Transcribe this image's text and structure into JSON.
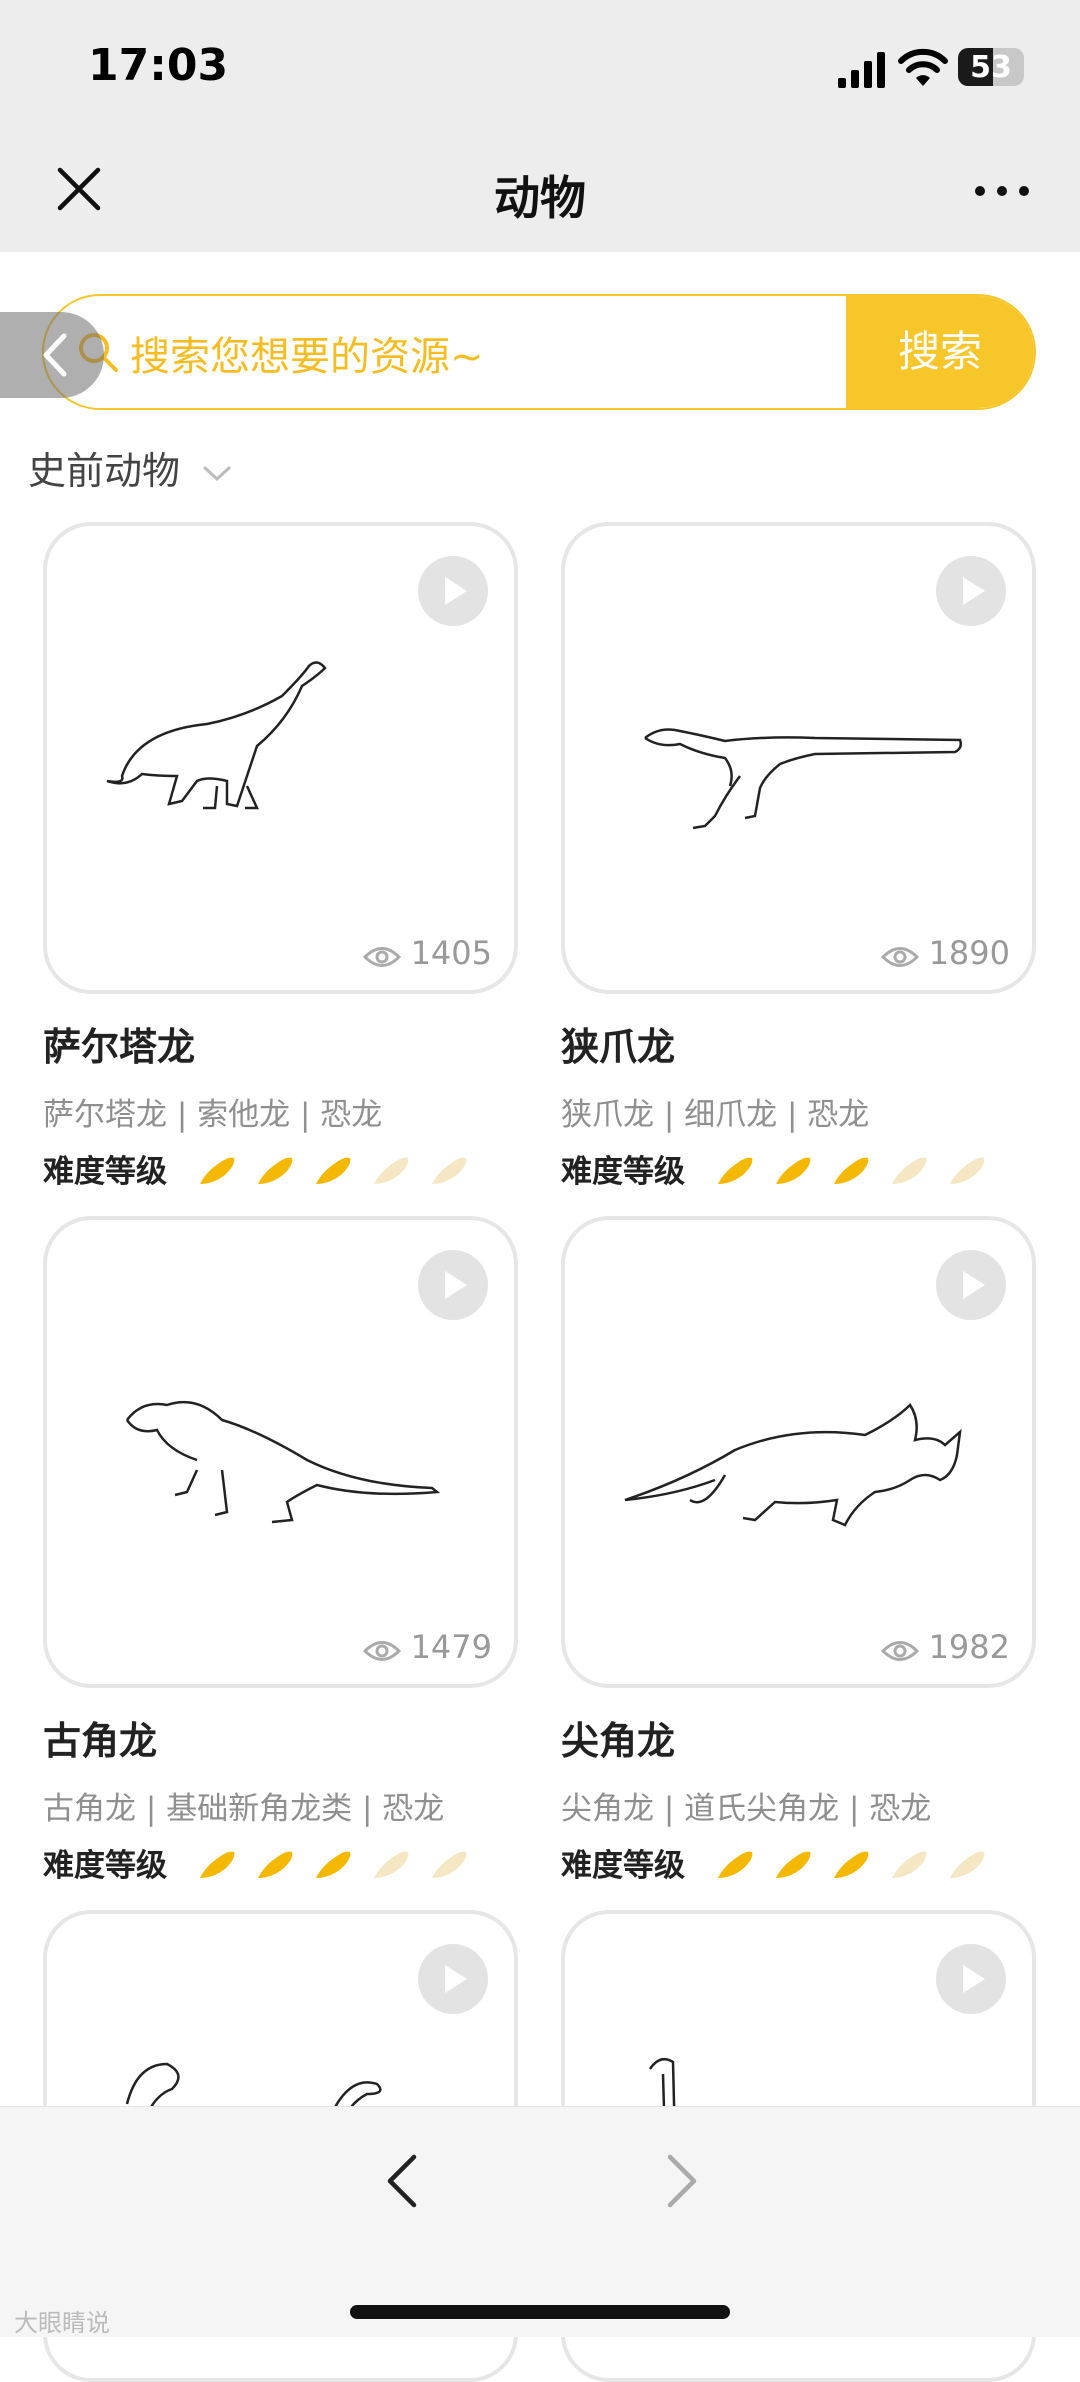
{
  "status_bar": {
    "time": "17:03",
    "battery": "53",
    "battery_level": 0.53
  },
  "nav": {
    "title": "动物"
  },
  "search": {
    "placeholder": "搜索您想要的资源~",
    "button": "搜索"
  },
  "category": {
    "label": "史前动物"
  },
  "difficulty_label": "难度等级",
  "colors": {
    "accent": "#f7c62a",
    "brush_active": "#f5b800",
    "brush_inactive": "#f6e7c4"
  },
  "cards": [
    {
      "name": "萨尔塔龙",
      "tags": "萨尔塔龙 | 索他龙 | 恐龙",
      "views": "1405",
      "difficulty": 3,
      "difficulty_max": 5
    },
    {
      "name": "狭爪龙",
      "tags": "狭爪龙 | 细爪龙 | 恐龙",
      "views": "1890",
      "difficulty": 3,
      "difficulty_max": 5
    },
    {
      "name": "古角龙",
      "tags": "古角龙 | 基础新角龙类 | 恐龙",
      "views": "1479",
      "difficulty": 3,
      "difficulty_max": 5
    },
    {
      "name": "尖角龙",
      "tags": "尖角龙 | 道氏尖角龙 | 恐龙",
      "views": "1982",
      "difficulty": 3,
      "difficulty_max": 5
    }
  ],
  "watermark": "大眼睛说"
}
